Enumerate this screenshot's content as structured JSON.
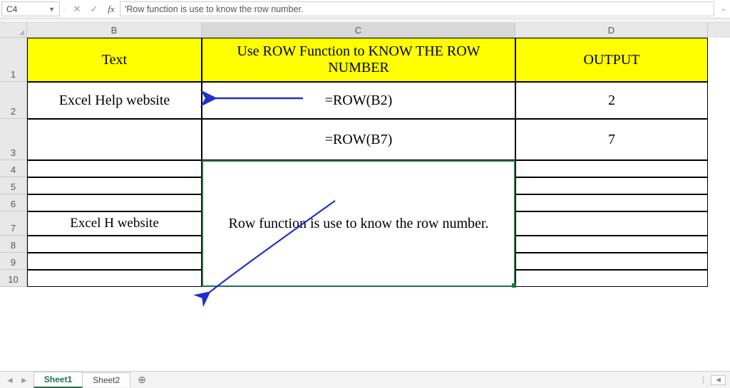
{
  "formula_bar": {
    "name_box": "C4",
    "cancel": "✕",
    "accept": "✓",
    "fx": "fx",
    "content": "'Row function is use to know the row number."
  },
  "columns": {
    "B": "B",
    "C": "C",
    "D": "D"
  },
  "rows": [
    "1",
    "2",
    "3",
    "4",
    "5",
    "6",
    "7",
    "8",
    "9",
    "10"
  ],
  "headers": {
    "B": "Text",
    "C": "Use ROW Function to KNOW THE ROW NUMBER",
    "D": "OUTPUT"
  },
  "data": {
    "B2": "Excel Help website",
    "C2": "=ROW(B2)",
    "D2": "2",
    "C3": "=ROW(B7)",
    "D3": "7",
    "B7": "Excel H website",
    "C_merged_note": "Row function is use to know the row number."
  },
  "tabs": {
    "sheet1": "Sheet1",
    "sheet2": "Sheet2"
  }
}
